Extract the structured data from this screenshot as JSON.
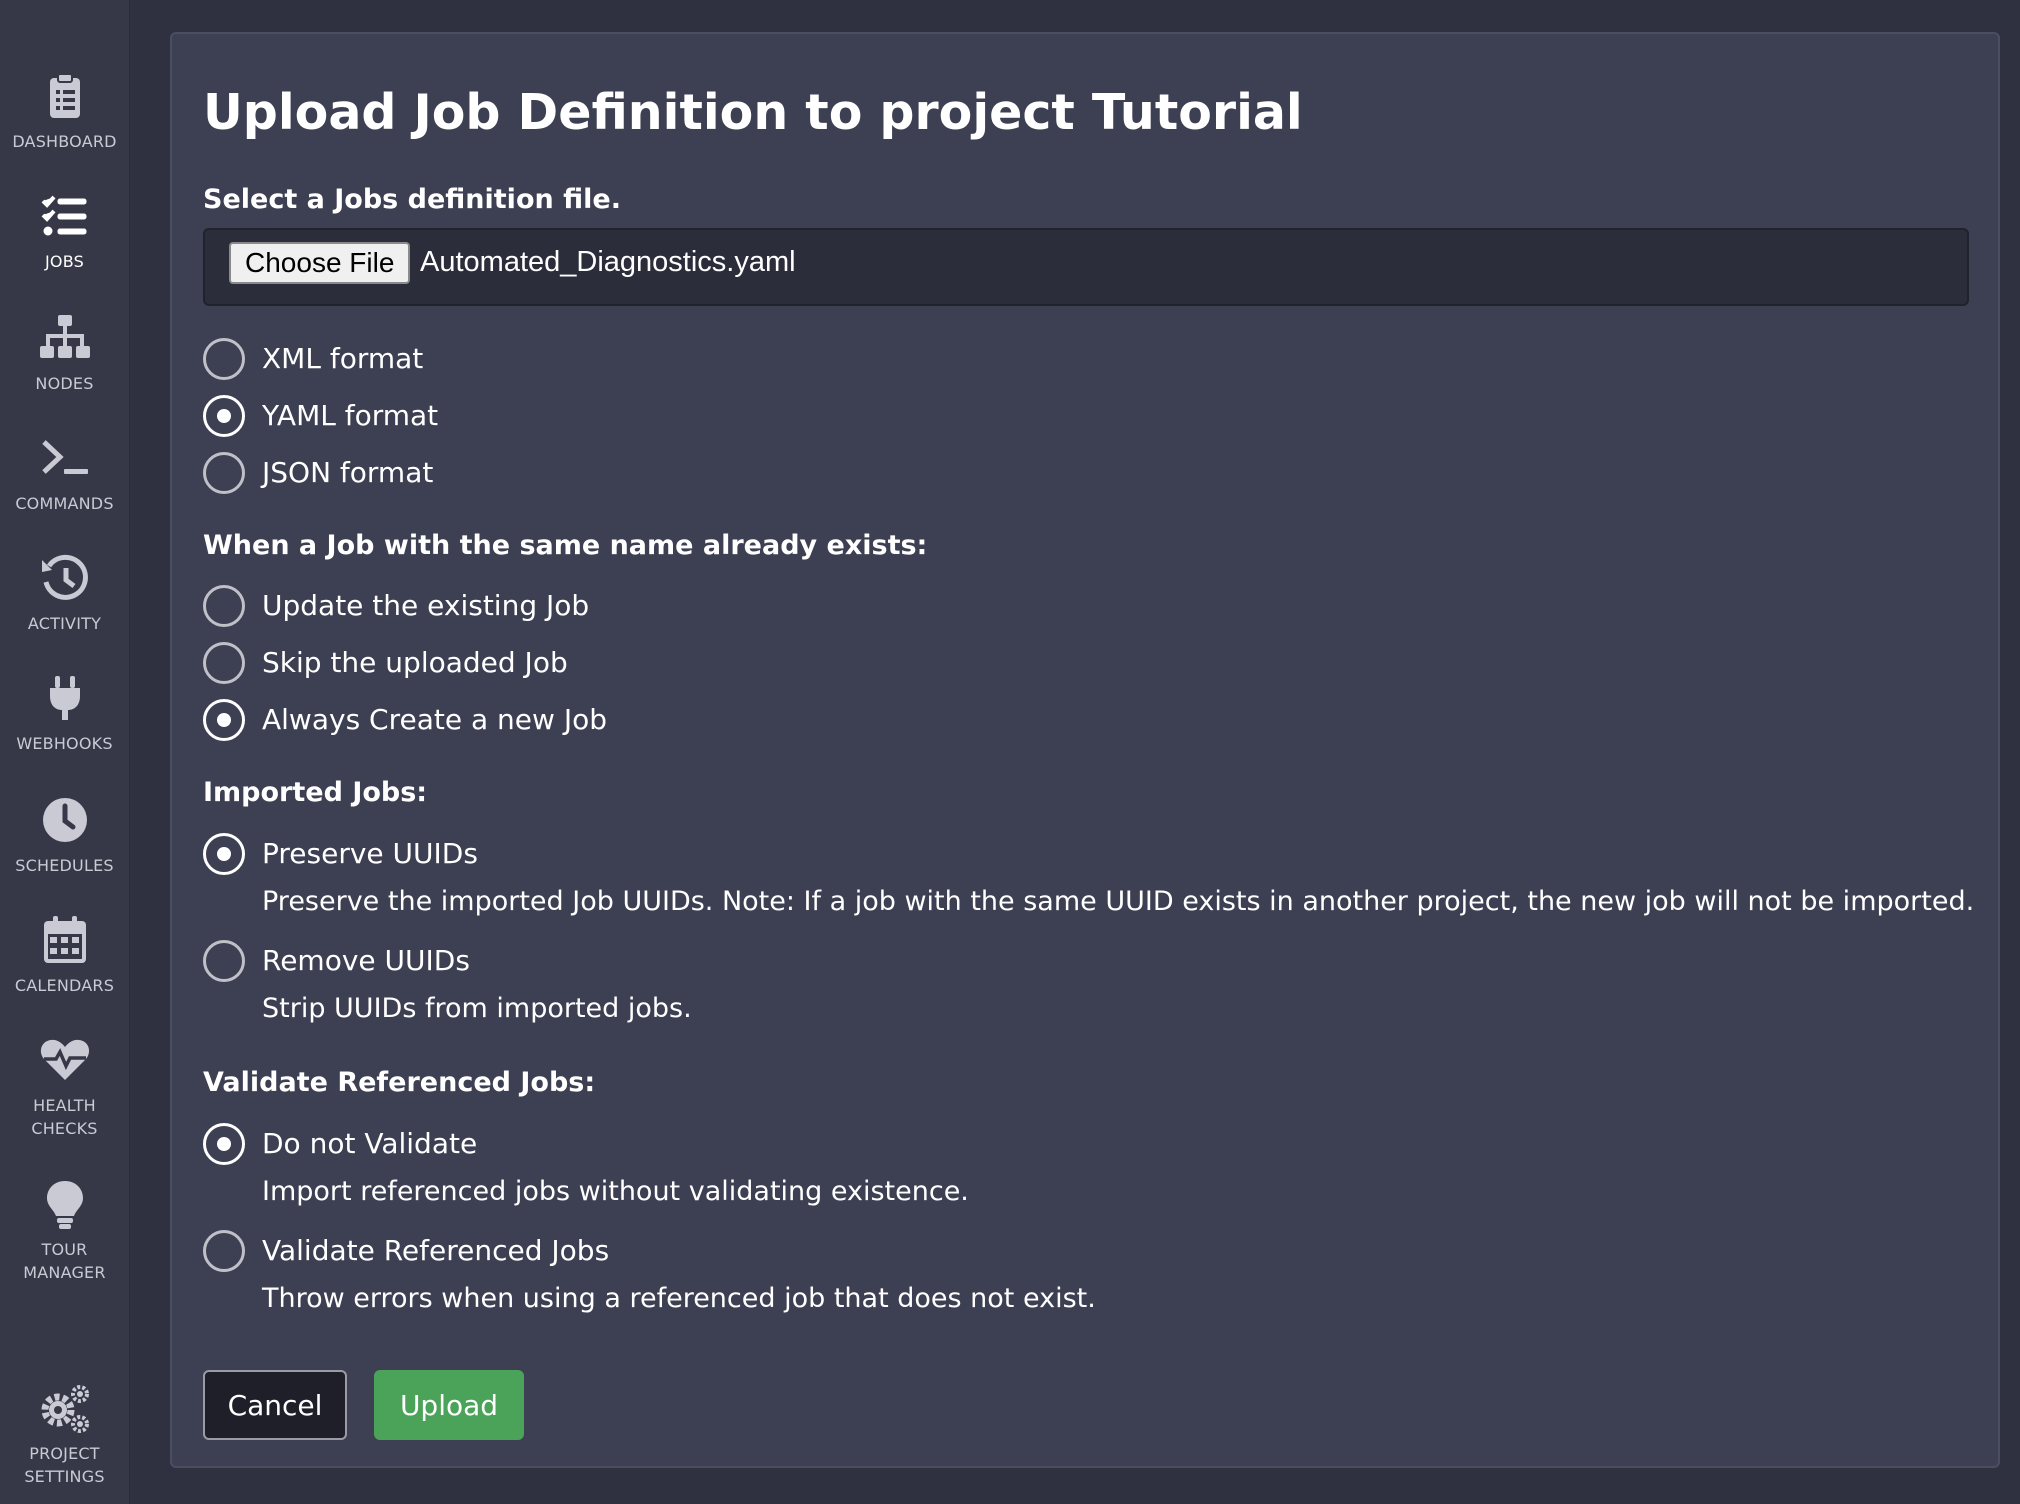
{
  "sidebar": {
    "items": [
      {
        "label": "DASHBOARD",
        "icon": "clipboard-icon",
        "active": false
      },
      {
        "label": "JOBS",
        "icon": "checklist-icon",
        "active": true
      },
      {
        "label": "NODES",
        "icon": "sitemap-icon",
        "active": false
      },
      {
        "label": "COMMANDS",
        "icon": "terminal-icon",
        "active": false
      },
      {
        "label": "ACTIVITY",
        "icon": "history-icon",
        "active": false
      },
      {
        "label": "WEBHOOKS",
        "icon": "plug-icon",
        "active": false
      },
      {
        "label": "SCHEDULES",
        "icon": "clock-icon",
        "active": false
      },
      {
        "label": "CALENDARS",
        "icon": "calendar-icon",
        "active": false
      },
      {
        "label": "HEALTH\nCHECKS",
        "icon": "heartbeat-icon",
        "active": false
      },
      {
        "label": "TOUR\nMANAGER",
        "icon": "lightbulb-icon",
        "active": false
      },
      {
        "label": "PROJECT\nSETTINGS",
        "icon": "gears-icon",
        "active": false
      }
    ]
  },
  "page": {
    "title": "Upload Job Definition to project Tutorial"
  },
  "file_section": {
    "label": "Select a Jobs definition file.",
    "choose_button": "Choose File",
    "file_name": "Automated_Diagnostics.yaml"
  },
  "format": {
    "options": [
      {
        "label": "XML format",
        "checked": false
      },
      {
        "label": "YAML format",
        "checked": true
      },
      {
        "label": "JSON format",
        "checked": false
      }
    ]
  },
  "duplicate": {
    "label": "When a Job with the same name already exists:",
    "options": [
      {
        "label": "Update the existing Job",
        "checked": false
      },
      {
        "label": "Skip the uploaded Job",
        "checked": false
      },
      {
        "label": "Always Create a new Job",
        "checked": true
      }
    ]
  },
  "imported": {
    "label": "Imported Jobs:",
    "options": [
      {
        "label": "Preserve UUIDs",
        "checked": true,
        "help": "Preserve the imported Job UUIDs. Note: If a job with the same UUID exists in another project, the new job will not be imported."
      },
      {
        "label": "Remove UUIDs",
        "checked": false,
        "help": "Strip UUIDs from imported jobs."
      }
    ]
  },
  "validate": {
    "label": "Validate Referenced Jobs:",
    "options": [
      {
        "label": "Do not Validate",
        "checked": true,
        "help": "Import referenced jobs without validating existence."
      },
      {
        "label": "Validate Referenced Jobs",
        "checked": false,
        "help": "Throw errors when using a referenced job that does not exist."
      }
    ]
  },
  "actions": {
    "cancel": "Cancel",
    "upload": "Upload",
    "upload_color": "#4aa358"
  }
}
